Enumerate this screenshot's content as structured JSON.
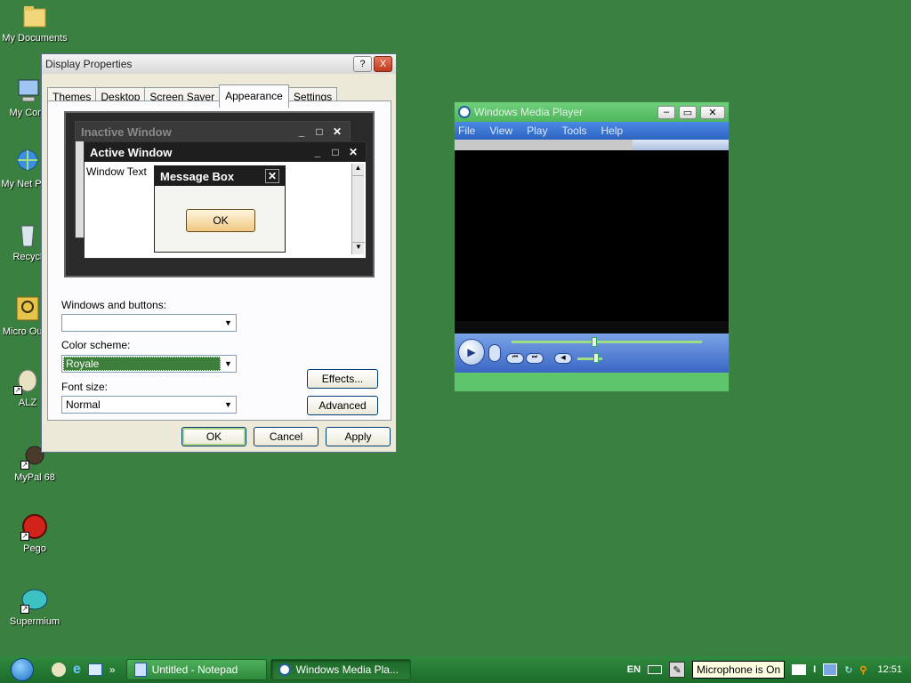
{
  "desktop": {
    "icons": [
      {
        "label": "My Documents"
      },
      {
        "label": "My Com"
      },
      {
        "label": "My Net Plac"
      },
      {
        "label": "Recycl"
      },
      {
        "label": "Micro Outlo"
      },
      {
        "label": "ALZ"
      },
      {
        "label": "MyPal 68"
      },
      {
        "label": "Pego"
      },
      {
        "label": "Supermium"
      }
    ]
  },
  "display_properties": {
    "title": "Display Properties",
    "help_btn": "?",
    "close_btn": "X",
    "tabs": [
      "Themes",
      "Desktop",
      "Screen Saver",
      "Appearance",
      "Settings"
    ],
    "active_tab": "Appearance",
    "preview": {
      "inactive_title": "Inactive Window",
      "active_title": "Active Window",
      "window_text": "Window Text",
      "message_box_title": "Message Box",
      "ok": "OK"
    },
    "windows_buttons_label": "Windows and buttons:",
    "windows_buttons_value": "",
    "color_scheme_label": "Color scheme:",
    "color_scheme_value": "Royale",
    "font_size_label": "Font size:",
    "font_size_value": "Normal",
    "effects": "Effects...",
    "advanced": "Advanced",
    "ok": "OK",
    "cancel": "Cancel",
    "apply": "Apply"
  },
  "media_player": {
    "title": "Windows Media Player",
    "menu": [
      "File",
      "View",
      "Play",
      "Tools",
      "Help"
    ]
  },
  "taskbar": {
    "tasks": [
      {
        "label": "Untitled - Notepad"
      },
      {
        "label": "Windows Media Pla..."
      }
    ],
    "language": "EN",
    "tooltip": "Microphone is On",
    "time": "12:51",
    "chevron": "»"
  },
  "colors": {
    "desktop": "#3a8040",
    "selection": "#3d7e3b",
    "wmp_frame": "#5ec56a"
  }
}
